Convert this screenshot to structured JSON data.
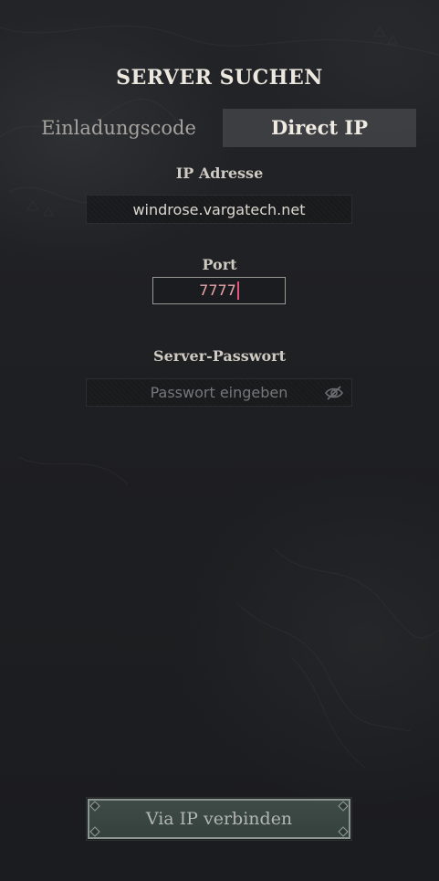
{
  "title": "SERVER SUCHEN",
  "tabs": {
    "invite": "Einladungscode",
    "direct": "Direct IP"
  },
  "ip": {
    "label": "IP Adresse",
    "value": "windrose.vargatech.net"
  },
  "port": {
    "label": "Port",
    "value": "7777"
  },
  "password": {
    "label": "Server-Passwort",
    "placeholder": "Passwort eingeben",
    "toggle_icon": "eye-slash-icon"
  },
  "connect_button": "Via IP verbinden",
  "colors": {
    "background": "#1e1f22",
    "active_tab": "#484a4e",
    "port_text": "#e8a5ad",
    "caret": "#e2557b",
    "button": "#3e4b47"
  }
}
